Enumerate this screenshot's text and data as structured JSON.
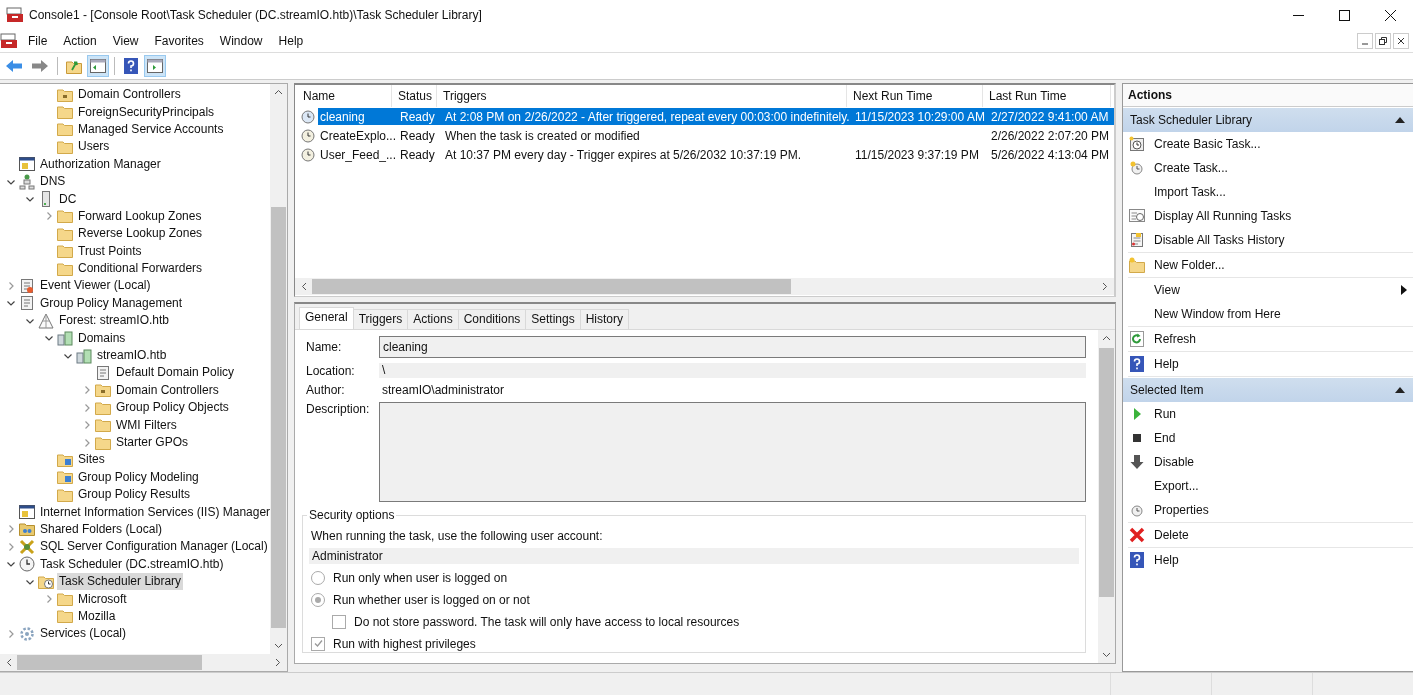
{
  "window": {
    "title": "Console1 - [Console Root\\Task Scheduler (DC.streamIO.htb)\\Task Scheduler Library]"
  },
  "menu": [
    "File",
    "Action",
    "View",
    "Favorites",
    "Window",
    "Help"
  ],
  "tree": [
    {
      "children": [
        {
          "children": [
            {
              "label": "Domain Controllers",
              "kind": "ou",
              "selected": false
            },
            {
              "label": "ForeignSecurityPrincipals",
              "kind": "folder",
              "selected": false
            },
            {
              "label": "Managed Service Accounts",
              "kind": "folder",
              "selected": false
            },
            {
              "label": "Users",
              "kind": "folder",
              "selected": false
            }
          ]
        }
      ]
    },
    {
      "label": "Authorization Manager",
      "kind": "app",
      "selected": false
    },
    {
      "label": "DNS",
      "kind": "network",
      "selected": false,
      "expanded": true,
      "children": [
        {
          "label": "DC",
          "kind": "server",
          "selected": false,
          "expanded": true,
          "children": [
            {
              "label": "Forward Lookup Zones",
              "kind": "folder",
              "selected": false,
              "expanded": false
            },
            {
              "label": "Reverse Lookup Zones",
              "kind": "folder",
              "selected": false
            },
            {
              "label": "Trust Points",
              "kind": "folder",
              "selected": false
            },
            {
              "label": "Conditional Forwarders",
              "kind": "folder",
              "selected": false
            }
          ]
        }
      ]
    },
    {
      "label": "Event Viewer (Local)",
      "kind": "log",
      "selected": false,
      "expanded": false
    },
    {
      "label": "Group Policy Management",
      "kind": "policy",
      "selected": false,
      "expanded": true,
      "children": [
        {
          "label": "Forest: streamIO.htb",
          "kind": "forest",
          "selected": false,
          "expanded": true,
          "children": [
            {
              "label": "Domains",
              "kind": "domains",
              "selected": false,
              "expanded": true,
              "children": [
                {
                  "label": "streamIO.htb",
                  "kind": "domains",
                  "selected": false,
                  "expanded": true,
                  "children": [
                    {
                      "label": "Default Domain Policy",
                      "kind": "policy",
                      "selected": false
                    },
                    {
                      "label": "Domain Controllers",
                      "kind": "ou",
                      "selected": false,
                      "expanded": false
                    },
                    {
                      "label": "Group Policy Objects",
                      "kind": "folder",
                      "selected": false,
                      "expanded": false
                    },
                    {
                      "label": "WMI Filters",
                      "kind": "folder",
                      "selected": false,
                      "expanded": false
                    },
                    {
                      "label": "Starter GPOs",
                      "kind": "folder",
                      "selected": false,
                      "expanded": false
                    }
                  ]
                }
              ]
            },
            {
              "label": "Sites",
              "kind": "sites",
              "selected": false
            },
            {
              "label": "Group Policy Modeling",
              "kind": "modeling",
              "selected": false
            },
            {
              "label": "Group Policy Results",
              "kind": "folder",
              "selected": false
            }
          ]
        }
      ]
    },
    {
      "label": "Internet Information Services (IIS) Manager",
      "kind": "app",
      "selected": false
    },
    {
      "label": "Shared Folders (Local)",
      "kind": "share",
      "selected": false,
      "expanded": false
    },
    {
      "label": "SQL Server Configuration Manager (Local)",
      "kind": "tools",
      "selected": false,
      "expanded": false
    },
    {
      "label": "Task Scheduler (DC.streamIO.htb)",
      "kind": "clock",
      "selected": false,
      "expanded": true,
      "children": [
        {
          "label": "Task Scheduler Library",
          "kind": "clockfolder",
          "selected": true,
          "expanded": true,
          "children": [
            {
              "label": "Microsoft",
              "kind": "folder",
              "selected": false,
              "expanded": false
            },
            {
              "label": "Mozilla",
              "kind": "folder",
              "selected": false
            }
          ]
        }
      ]
    },
    {
      "label": "Services (Local)",
      "kind": "gear",
      "selected": false,
      "expanded": false
    }
  ],
  "tasks": {
    "columns": [
      "Name",
      "Status",
      "Triggers",
      "Next Run Time",
      "Last Run Time"
    ],
    "rows": [
      {
        "selected": true,
        "cells": [
          "cleaning",
          "Ready",
          "At 2:08 PM on 2/26/2022 - After triggered, repeat every 00:03:00 indefinitely.",
          "11/15/2023 10:29:00 AM",
          "2/27/2022 9:41:00 AM"
        ]
      },
      {
        "selected": false,
        "cells": [
          "CreateExplo...",
          "Ready",
          "When the task is created or modified",
          "",
          "2/26/2022 2:07:20 PM"
        ]
      },
      {
        "selected": false,
        "cells": [
          "User_Feed_...",
          "Ready",
          "At 10:37 PM every day - Trigger expires at 5/26/2032 10:37:19 PM.",
          "11/15/2023 9:37:19 PM",
          "5/26/2022 4:13:04 PM"
        ]
      }
    ]
  },
  "details": {
    "tabs": [
      {
        "label": "General",
        "selected": true
      },
      {
        "label": "Triggers",
        "selected": false
      },
      {
        "label": "Actions",
        "selected": false
      },
      {
        "label": "Conditions",
        "selected": false
      },
      {
        "label": "Settings",
        "selected": false
      },
      {
        "label": "History",
        "selected": false
      }
    ],
    "name": {
      "label": "Name:",
      "value": "cleaning"
    },
    "location": {
      "label": "Location:",
      "value": "\\"
    },
    "author": {
      "label": "Author:",
      "value": "streamIO\\administrator"
    },
    "description": {
      "label": "Description:"
    },
    "security": {
      "title": "Security options",
      "prompt": "When running the task, use the following user account:",
      "account": "Administrator",
      "radios": [
        {
          "label": "Run only when user is logged on",
          "selected": false
        },
        {
          "label": "Run whether user is logged on or not",
          "selected": true
        }
      ],
      "store_password": {
        "label": "Do not store password.  The task will only have access to local resources",
        "checked": false
      },
      "highest": {
        "label": "Run with highest privileges",
        "checked": true
      }
    }
  },
  "actions": {
    "title": "Actions",
    "sections": [
      {
        "title": "Task Scheduler Library",
        "expanded": true,
        "groups": [
          [
            {
              "label": "Create Basic Task...",
              "kind": "basic"
            },
            {
              "label": "Create Task...",
              "kind": "create"
            },
            {
              "label": "Import Task..."
            },
            {
              "label": "Display All Running Tasks",
              "kind": "running"
            },
            {
              "label": "Disable All Tasks History",
              "kind": "history"
            }
          ],
          [
            {
              "label": "New Folder...",
              "kind": "folder"
            }
          ],
          [
            {
              "label": "View",
              "submenu": true
            },
            {
              "label": "New Window from Here"
            }
          ],
          [
            {
              "label": "Refresh",
              "kind": "refresh"
            }
          ],
          [
            {
              "label": "Help",
              "kind": "help"
            }
          ]
        ]
      },
      {
        "title": "Selected Item",
        "expanded": true,
        "groups": [
          [
            {
              "label": "Run",
              "kind": "run"
            },
            {
              "label": "End",
              "kind": "end"
            },
            {
              "label": "Disable",
              "kind": "disable"
            },
            {
              "label": "Export..."
            },
            {
              "label": "Properties",
              "kind": "properties"
            }
          ],
          [
            {
              "label": "Delete",
              "kind": "delete"
            }
          ],
          [
            {
              "label": "Help",
              "kind": "help"
            }
          ]
        ]
      }
    ]
  }
}
